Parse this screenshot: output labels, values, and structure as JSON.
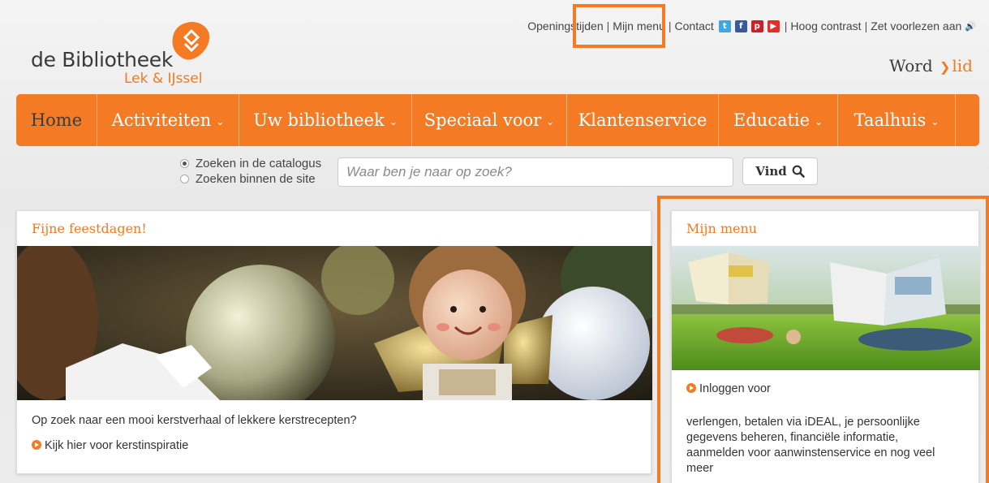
{
  "header": {
    "logo_main": "de Bibliotheek",
    "logo_sub": "Lek & IJssel",
    "toplinks": [
      "Openingstijden",
      "Mijn menu",
      "Contact"
    ],
    "accessibility": [
      "Hoog contrast",
      "Zet voorlezen aan"
    ],
    "social_icons": [
      "twitter-icon",
      "facebook-icon",
      "pinterest-icon",
      "youtube-icon"
    ],
    "word": "Word",
    "lid": "lid"
  },
  "nav": {
    "items": [
      {
        "label": "Home",
        "dropdown": false
      },
      {
        "label": "Activiteiten",
        "dropdown": true
      },
      {
        "label": "Uw bibliotheek",
        "dropdown": true
      },
      {
        "label": "Speciaal voor",
        "dropdown": true
      },
      {
        "label": "Klantenservice",
        "dropdown": false
      },
      {
        "label": "Educatie",
        "dropdown": true
      },
      {
        "label": "Taalhuis",
        "dropdown": true
      }
    ]
  },
  "search": {
    "option_catalogus": "Zoeken in de catalogus",
    "option_site": "Zoeken binnen de site",
    "placeholder": "Waar ben je naar op zoek?",
    "button": "Vind"
  },
  "main_card": {
    "title": "Fijne feestdagen!",
    "text": "Op zoek naar een mooi kerstverhaal of lekkere kerstrecepten?",
    "link": "Kijk hier voor kerstinspiratie"
  },
  "side_card": {
    "title": "Mijn menu",
    "link": "Inloggen voor",
    "desc": "verlengen, betalen via iDEAL, je persoonlijke gegevens beheren, financiële informatie, aanmelden voor aanwinstenservice en nog veel meer"
  },
  "colors": {
    "brand_orange": "#f47a23",
    "nav_home_text": "#3c3c3c"
  }
}
